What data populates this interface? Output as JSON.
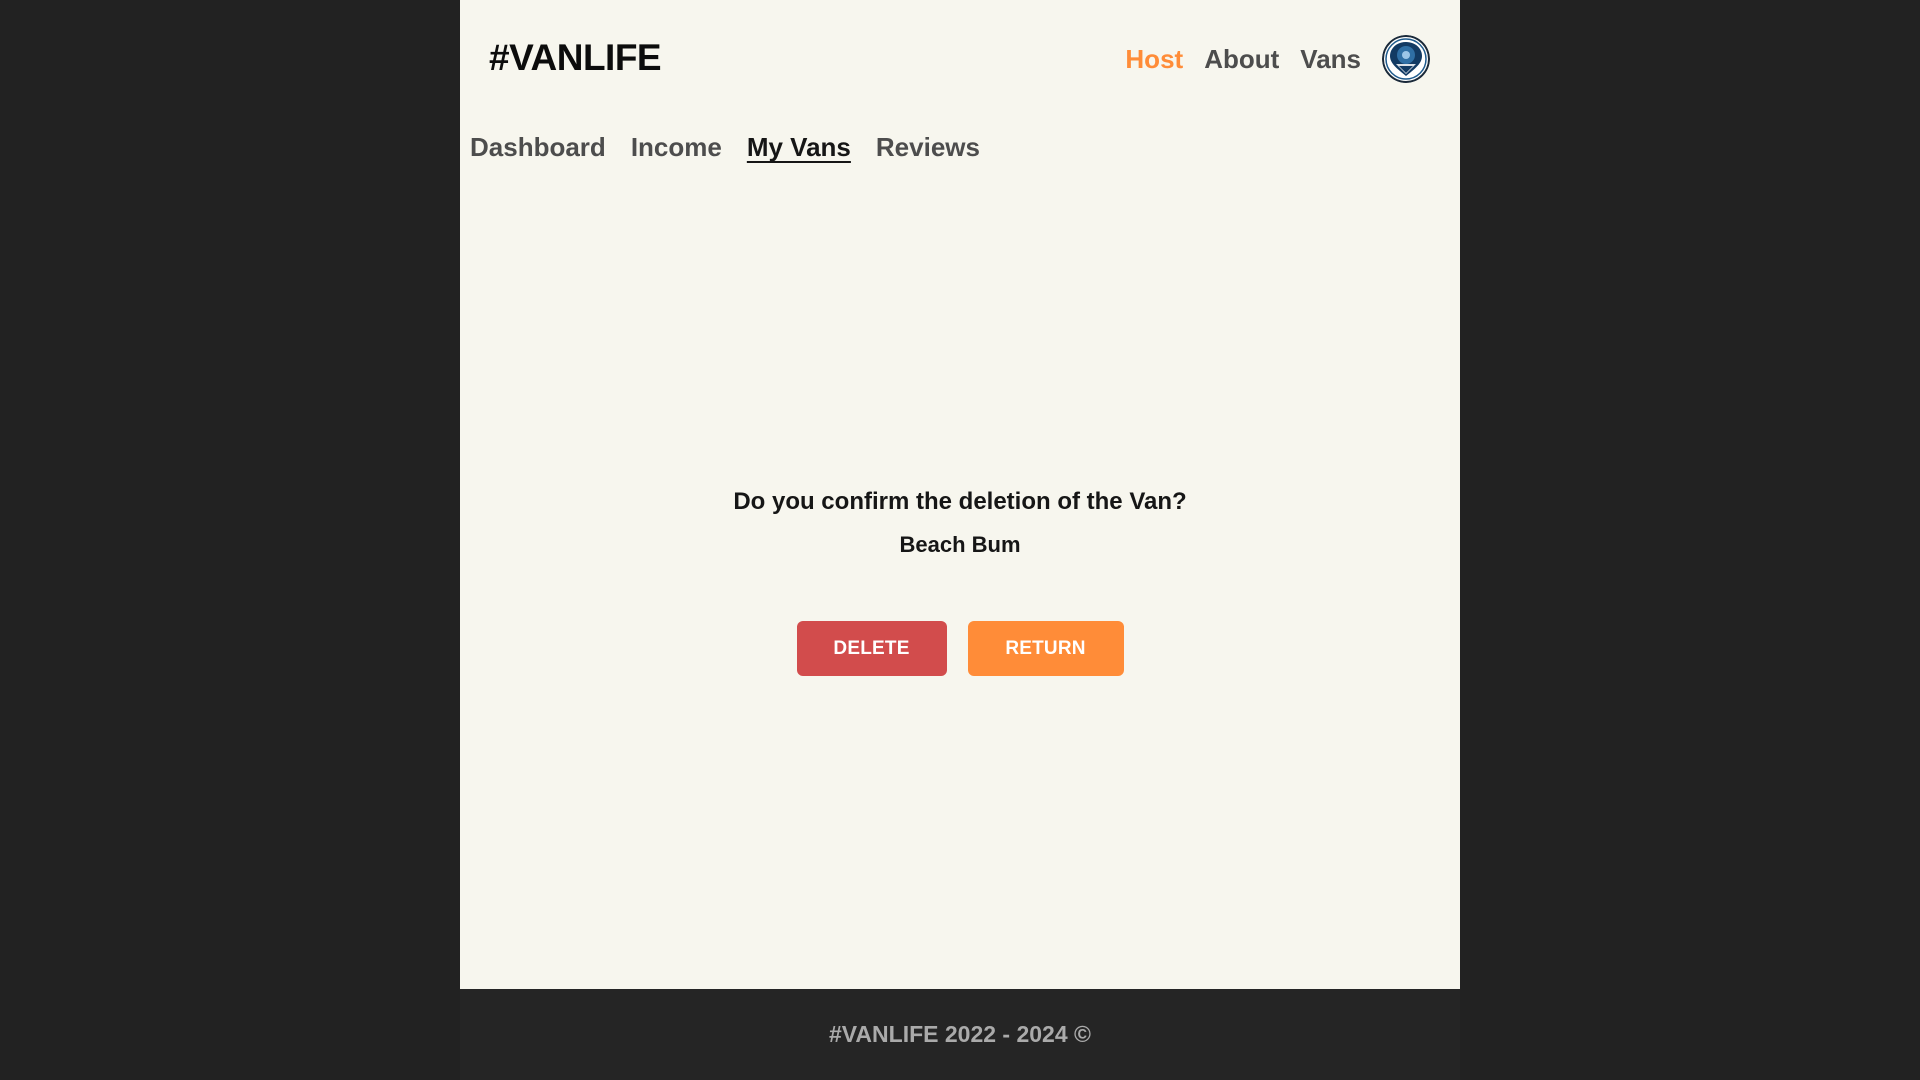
{
  "brand": {
    "logo": "#VANLIFE"
  },
  "main_nav": {
    "items": [
      {
        "label": "Host",
        "active": true
      },
      {
        "label": "About",
        "active": false
      },
      {
        "label": "Vans",
        "active": false
      }
    ],
    "avatar_icon": "user-avatar-icon"
  },
  "host_nav": {
    "items": [
      {
        "label": "Dashboard",
        "active": false
      },
      {
        "label": "Income",
        "active": false
      },
      {
        "label": "My Vans",
        "active": true
      },
      {
        "label": "Reviews",
        "active": false
      }
    ]
  },
  "confirm_dialog": {
    "question": "Do you confirm the deletion of the Van?",
    "van_name": "Beach Bum",
    "delete_label": "DELETE",
    "return_label": "RETURN"
  },
  "footer": {
    "text": "#VANLIFE 2022 - 2024 ©"
  },
  "colors": {
    "accent": "#ff8c38",
    "danger": "#d24c4c",
    "page_background": "#f7f6ee",
    "outer_background": "#222222",
    "footer_background": "#252525"
  }
}
